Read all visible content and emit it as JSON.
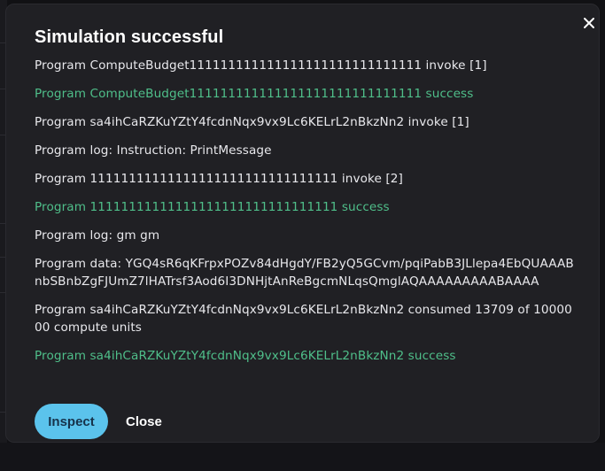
{
  "modal": {
    "title": "Simulation successful",
    "close_icon": "close-icon",
    "log_lines": [
      {
        "text": "Program ComputeBudget111111111111111111111111111111 invoke [1]",
        "status": "normal"
      },
      {
        "text": "Program ComputeBudget111111111111111111111111111111 success",
        "status": "success"
      },
      {
        "text": "Program sa4ihCaRZKuYZtY4fcdnNqx9vx9Lc6KELrL2nBkzNn2 invoke [1]",
        "status": "normal"
      },
      {
        "text": "Program log: Instruction: PrintMessage",
        "status": "normal"
      },
      {
        "text": "Program 11111111111111111111111111111111 invoke [2]",
        "status": "normal"
      },
      {
        "text": "Program 11111111111111111111111111111111 success",
        "status": "success"
      },
      {
        "text": "Program log: gm gm",
        "status": "normal"
      },
      {
        "text": "Program data: YGQ4sR6qKFrpxPOZv84dHgdY/FB2yQ5GCvm/pqiPabB3JLlepa4EbQUAAABnbSBnbZgFJUmZ7lHATrsf3Aod6I3DNHjtAnReBgcmNLqsQmglAQAAAAAAAAABAAAA",
        "status": "normal"
      },
      {
        "text": "Program sa4ihCaRZKuYZtY4fcdnNqx9vx9Lc6KELrL2nBkzNn2 consumed 13709 of 1000000 compute units",
        "status": "normal"
      },
      {
        "text": "Program sa4ihCaRZKuYZtY4fcdnNqx9vx9Lc6KELrL2nBkzNn2 success",
        "status": "success"
      }
    ],
    "buttons": {
      "inspect_label": "Inspect",
      "close_label": "Close"
    },
    "colors": {
      "success": "#4fbf8a",
      "accent": "#5bc3ec",
      "text": "#e8e8ec",
      "background": "#202024"
    }
  }
}
